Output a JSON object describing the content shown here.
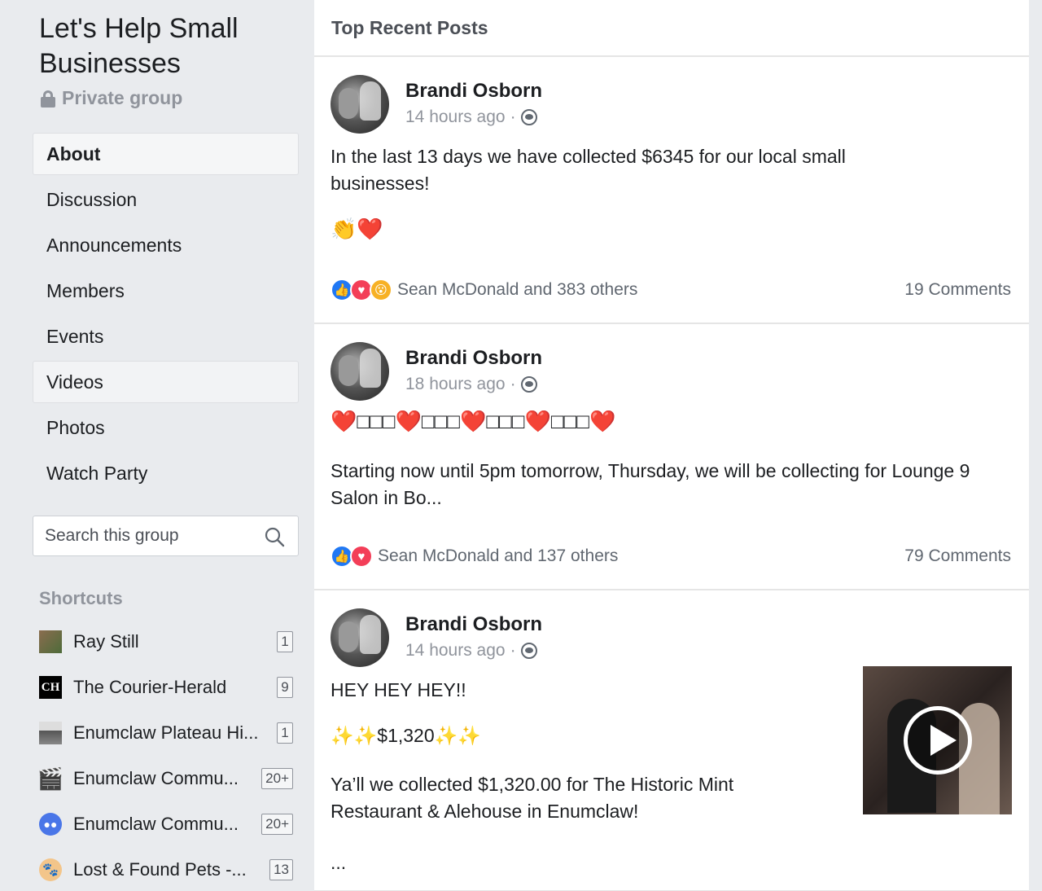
{
  "group": {
    "title": "Let's Help Small Businesses",
    "privacy": "Private group"
  },
  "nav": [
    {
      "label": "About"
    },
    {
      "label": "Discussion"
    },
    {
      "label": "Announcements"
    },
    {
      "label": "Members"
    },
    {
      "label": "Events"
    },
    {
      "label": "Videos"
    },
    {
      "label": "Photos"
    },
    {
      "label": "Watch Party"
    }
  ],
  "search": {
    "placeholder": "Search this group"
  },
  "shortcuts": {
    "title": "Shortcuts",
    "items": [
      {
        "label": "Ray Still",
        "badge": "1",
        "icon": "user-avatar-icon"
      },
      {
        "label": "The Courier-Herald",
        "badge": "9",
        "icon": "ch-logo-icon"
      },
      {
        "label": "Enumclaw Plateau Hi...",
        "badge": "1",
        "icon": "group-photo-icon"
      },
      {
        "label": "Enumclaw Commu...",
        "badge": "20+",
        "icon": "clapper-icon"
      },
      {
        "label": "Enumclaw Commu...",
        "badge": "20+",
        "icon": "group-icon"
      },
      {
        "label": "Lost & Found Pets -...",
        "badge": "13",
        "icon": "paw-icon"
      }
    ]
  },
  "main": {
    "header": "Top Recent Posts",
    "posts": [
      {
        "author": "Brandi Osborn",
        "time": "14 hours ago",
        "text": "In the last 13 days we have collected $6345 for our local small businesses!",
        "emoji": "👏❤️",
        "reactions": "Sean McDonald and 383 others",
        "comments": "19 Comments"
      },
      {
        "author": "Brandi Osborn",
        "time": "18 hours ago",
        "emoji": "❤️□□□❤️□□□❤️□□□❤️□□□❤️",
        "text": "Starting now until 5pm tomorrow, Thursday, we will be collecting for Lounge 9 Salon in Bo...",
        "reactions": "Sean McDonald and 137 others",
        "comments": "79 Comments"
      },
      {
        "author": "Brandi Osborn",
        "time": "14 hours ago",
        "line1": "HEY HEY HEY!!",
        "line2": "✨✨$1,320✨✨",
        "text": "Ya’ll we collected $1,320.00 for The Historic Mint Restaurant & Alehouse in Enumclaw!",
        "more": "..."
      }
    ]
  },
  "colors": {
    "background": "#e9ebee",
    "like": "#2078f4",
    "love": "#f33e58",
    "wow": "#f7b125"
  }
}
